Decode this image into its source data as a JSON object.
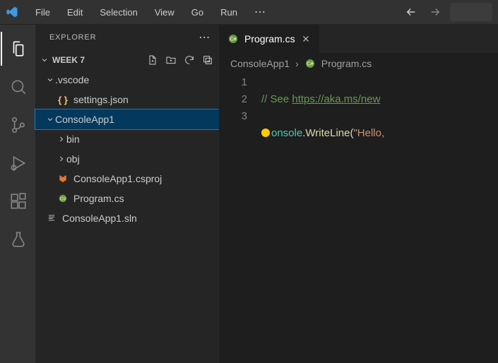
{
  "menubar": {
    "items": [
      "File",
      "Edit",
      "Selection",
      "View",
      "Go",
      "Run"
    ],
    "ellipsis": "⋯"
  },
  "activity_bar": {
    "items": [
      {
        "name": "explorer",
        "active": true
      },
      {
        "name": "search",
        "active": false
      },
      {
        "name": "source-control",
        "active": false
      },
      {
        "name": "run-debug",
        "active": false
      },
      {
        "name": "extensions",
        "active": false
      },
      {
        "name": "testing",
        "active": false
      }
    ]
  },
  "sidebar": {
    "title": "EXPLORER",
    "actions_ellipsis": "⋯",
    "workspace": "WEEK 7",
    "toolbar": [
      "new-file",
      "new-folder",
      "refresh",
      "collapse-all"
    ],
    "tree": {
      "vscode_folder": ".vscode",
      "settings_json": "settings.json",
      "consoleapp_folder": "ConsoleApp1",
      "bin": "bin",
      "obj": "obj",
      "csproj": "ConsoleApp1.csproj",
      "program_cs": "Program.cs",
      "sln": "ConsoleApp1.sln"
    }
  },
  "editor": {
    "tab": {
      "label": "Program.cs"
    },
    "breadcrumb": {
      "folder": "ConsoleApp1",
      "file": "Program.cs",
      "sep": "›"
    },
    "line_numbers": [
      "1",
      "2",
      "3"
    ],
    "code": {
      "line1_comment": "// See ",
      "line1_link": "https://aka.ms/new",
      "line2_prefix": "C",
      "line2_type": "onsole",
      "line2_dot": ".",
      "line2_method": "WriteLine",
      "line2_paren": "(",
      "line2_string": "\"Hello,"
    }
  },
  "colors": {
    "csharp": "#6a9a3b",
    "json_braces": "#f0c674",
    "xml": "#e37933"
  }
}
